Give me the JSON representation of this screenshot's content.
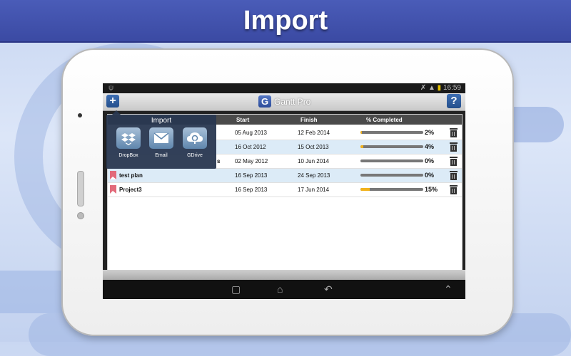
{
  "header": {
    "title": "Import"
  },
  "status_bar": {
    "usb_icon": "usb-icon",
    "time": "16:59"
  },
  "app": {
    "title": "Gantt Pro",
    "logo": "G",
    "add_button": "+",
    "help_button": "?"
  },
  "table": {
    "columns": [
      "Start",
      "Finish",
      "% Completed"
    ],
    "rows": [
      {
        "name": "",
        "start": "05 Aug 2013",
        "finish": "12 Feb 2014",
        "progress": 0.02,
        "percent": "2%"
      },
      {
        "name": "",
        "start": "16 Oct 2012",
        "finish": "15 Oct 2013",
        "progress": 0.04,
        "percent": "4%"
      },
      {
        "name": "s",
        "start": "02 May 2012",
        "finish": "10 Jun 2014",
        "progress": 0.0,
        "percent": "0%"
      },
      {
        "name": "test plan",
        "start": "16 Sep 2013",
        "finish": "24 Sep 2013",
        "progress": 0.0,
        "percent": "0%"
      },
      {
        "name": "Project3",
        "start": "16 Sep 2013",
        "finish": "17 Jun 2014",
        "progress": 0.15,
        "percent": "15%"
      }
    ]
  },
  "import_popup": {
    "title": "Import",
    "items": [
      {
        "label": "DropBox",
        "icon": "dropbox-icon"
      },
      {
        "label": "Email",
        "icon": "email-icon"
      },
      {
        "label": "GDrive",
        "icon": "gdrive-icon"
      }
    ]
  },
  "navbar": {
    "back": "back-icon",
    "home": "home-icon",
    "recents": "recents-icon"
  },
  "colors": {
    "header": "#3b4aa3",
    "progress_fill": "#f2b21c",
    "popup": "#283750",
    "row_alt": "#dcebf7"
  }
}
